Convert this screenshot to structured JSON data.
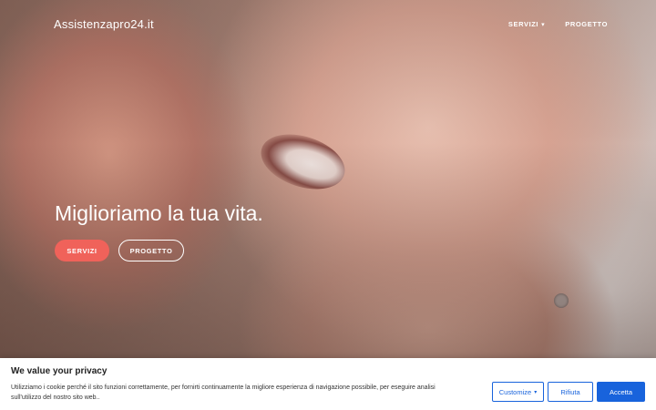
{
  "brand": {
    "name": "Assistenzapro24.it"
  },
  "nav": {
    "items": [
      {
        "label": "SERVIZI",
        "icon": "chevron-down-icon",
        "icon_glyph": "▾"
      },
      {
        "label": "PROGETTO"
      }
    ]
  },
  "hero": {
    "headline": "Miglioriamo la tua vita.",
    "primary_button": "SERVIZI",
    "secondary_button": "PROGETTO",
    "accent_color": "#f0625a"
  },
  "cookie_banner": {
    "title": "We value your privacy",
    "text": "Utilizziamo i cookie perché il sito funzioni correttamente, per fornirti continuamente la migliore esperienza di navigazione possibile, per eseguire analisi sull'utilizzo del nostro sito web..",
    "customize_label": "Customize",
    "customize_icon_glyph": "▾",
    "reject_label": "Rifiuta",
    "accept_label": "Accetta",
    "accent_color": "#1863dc"
  }
}
